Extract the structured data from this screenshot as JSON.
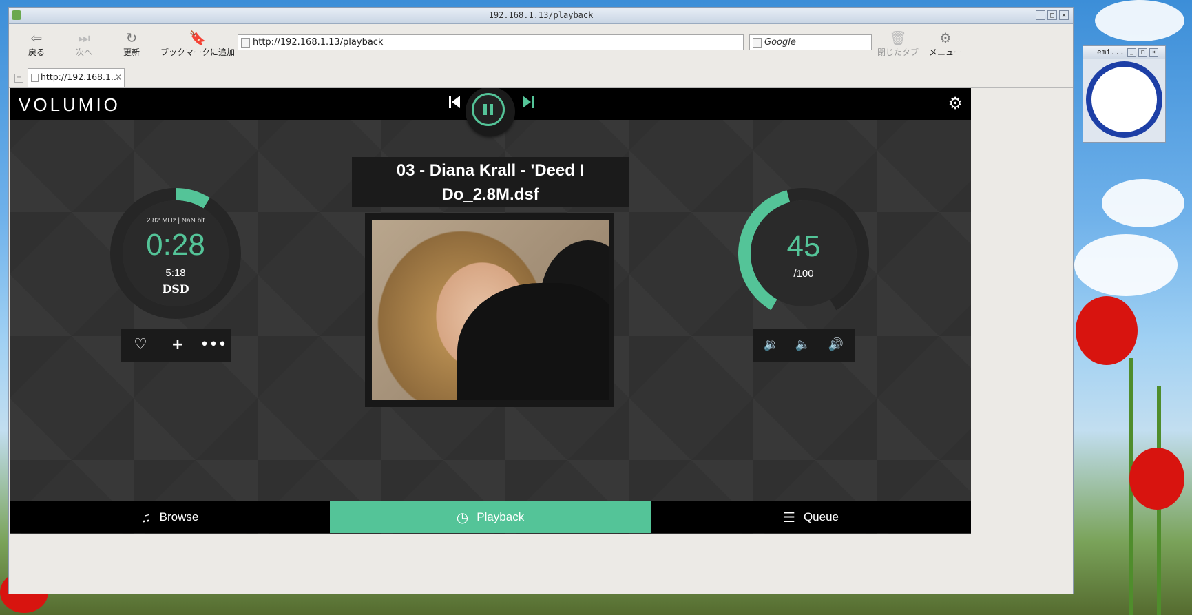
{
  "window": {
    "title": "192.168.1.13/playback"
  },
  "toolbar": {
    "back": "戻る",
    "forward": "次へ",
    "reload": "更新",
    "bookmark": "ブックマークに追加",
    "closed_tabs": "閉じたタブ",
    "menu": "メニュー"
  },
  "address": {
    "url": "http://192.168.1.13/playback",
    "search_placeholder": "Google"
  },
  "tab": {
    "label": "http://192.168.1.…"
  },
  "player": {
    "logo": "VOLUMIO",
    "track_title": "03 - Diana Krall - 'Deed I Do_2.8M.dsf",
    "sample_info": "2.82 MHz | NaN bit",
    "elapsed": "0:28",
    "duration": "5:18",
    "format": "DSD",
    "progress_fraction": 0.088,
    "volume": "45",
    "volume_max": "/100",
    "volume_fraction": 0.45,
    "accent_color": "#54c498",
    "state": "playing"
  },
  "footer": {
    "browse": "Browse",
    "playback": "Playback",
    "queue": "Queue"
  },
  "clock_widget": {
    "title": "emi..."
  }
}
